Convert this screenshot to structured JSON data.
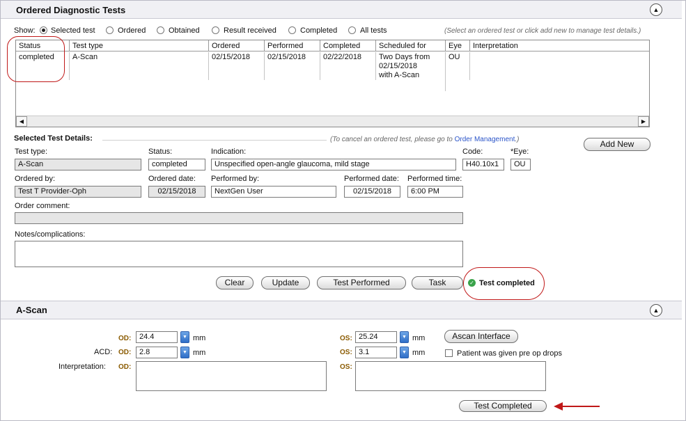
{
  "ordered": {
    "title": "Ordered Diagnostic Tests",
    "collapse_glyph": "▲",
    "show_label": "Show:",
    "filters": [
      "Selected test",
      "Ordered",
      "Obtained",
      "Result received",
      "Completed",
      "All tests"
    ],
    "hint": "(Select an ordered test or click add new to manage test details.)",
    "columns": [
      "Status",
      "Test type",
      "Ordered",
      "Performed",
      "Completed",
      "Scheduled for",
      "Eye",
      "Interpretation"
    ],
    "row": {
      "status": "completed",
      "test_type": "A-Scan",
      "ordered": "02/15/2018",
      "performed": "02/15/2018",
      "completed": "02/22/2018",
      "scheduled_for": "Two Days from 02/15/2018 with A-Scan",
      "eye": "OU",
      "interpretation": ""
    }
  },
  "details": {
    "heading": "Selected Test Details:",
    "cancel_note_prefix": "(To cancel an ordered test, please go to ",
    "cancel_note_link": "Order Management",
    "cancel_note_suffix": ".)",
    "add_new": "Add New",
    "test_type_label": "Test type:",
    "test_type": "A-Scan",
    "status_label": "Status:",
    "status": "completed",
    "indication_label": "Indication:",
    "indication": "Unspecified open-angle glaucoma, mild stage",
    "code_label": "Code:",
    "code": "H40.10x1",
    "eye_label": "*Eye:",
    "eye": "OU",
    "ordered_by_label": "Ordered by:",
    "ordered_by": "Test T Provider-Oph",
    "ordered_date_label": "Ordered date:",
    "ordered_date": "02/15/2018",
    "performed_by_label": "Performed by:",
    "performed_by": "NextGen User",
    "performed_date_label": "Performed date:",
    "performed_date": "02/15/2018",
    "performed_time_label": "Performed time:",
    "performed_time": "6:00 PM",
    "order_comment_label": "Order comment:",
    "notes_label": "Notes/complications:",
    "buttons": {
      "clear": "Clear",
      "update": "Update",
      "test_performed": "Test Performed",
      "task": "Task"
    },
    "completed_status": "Test completed",
    "status_color": "#3aa34a"
  },
  "ascan": {
    "title": "A-Scan",
    "od_label": "OD:",
    "os_label": "OS:",
    "od_value": "24.4",
    "os_value": "25.24",
    "unit": "mm",
    "acd_label": "ACD:",
    "acd_od": "2.8",
    "acd_os": "3.1",
    "interpretation_label": "Interpretation:",
    "interface_button": "Ascan Interface",
    "pre_op_drops": "Patient was given pre op drops",
    "pre_op_checked": false,
    "test_completed_button": "Test Completed",
    "annotation_color": "#c01818"
  }
}
